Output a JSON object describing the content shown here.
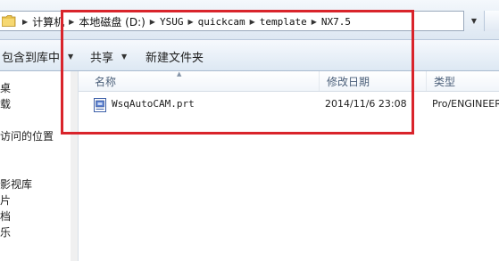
{
  "address_bar": {
    "breadcrumbs": [
      "计算机",
      "本地磁盘 (D:)",
      "YSUG",
      "quickcam",
      "template",
      "NX7.5"
    ]
  },
  "toolbar": {
    "include_in_library_label": "包含到库中",
    "share_label": "共享",
    "new_folder_label": "新建文件夹"
  },
  "nav_pane": {
    "items": [
      "桌",
      "载",
      "访问的位置",
      "影视库",
      "片",
      "档",
      "乐"
    ]
  },
  "file_list": {
    "columns": [
      "名称",
      "修改日期",
      "类型"
    ],
    "rows": [
      {
        "name": "WsqAutoCAM.prt",
        "modified": "2014/11/6 23:08",
        "type": "Pro/ENGINEER"
      }
    ]
  },
  "annotation": {
    "highlight_color": "#d9242b"
  }
}
